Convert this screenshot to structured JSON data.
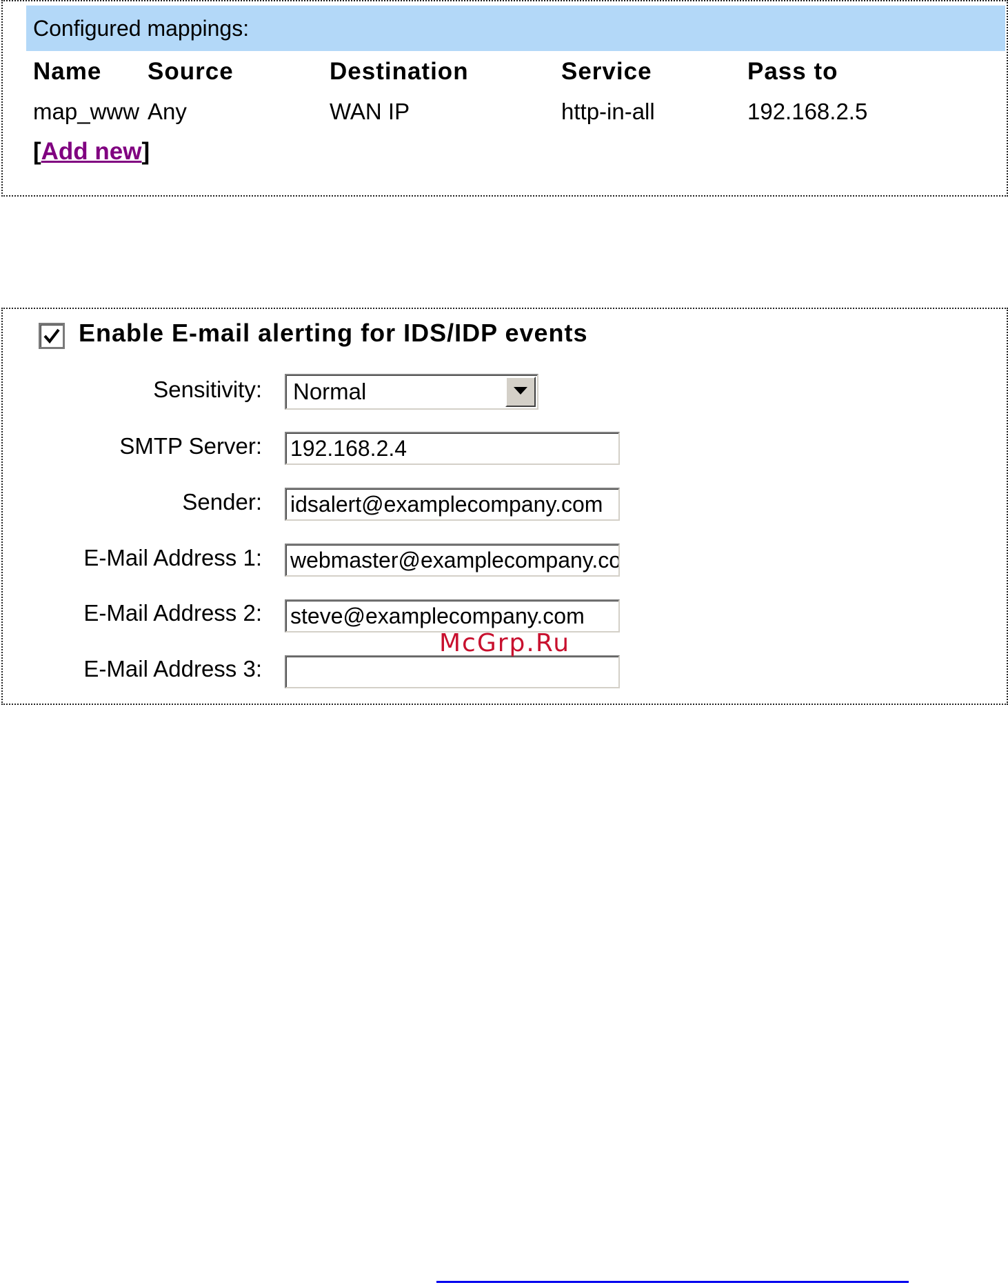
{
  "mappings": {
    "header": "Configured mappings:",
    "columns": [
      "Name",
      "Source",
      "Destination",
      "Service",
      "Pass to"
    ],
    "rows": [
      {
        "name": "map_www",
        "source": "Any",
        "destination": "WAN IP",
        "service": "http-in-all",
        "pass_to": "192.168.2.5"
      }
    ],
    "add_new_open": "[",
    "add_new_label": "Add new",
    "add_new_close": "]"
  },
  "alerting": {
    "enable_label": "Enable E-mail alerting for IDS/IDP events",
    "enabled": true,
    "fields": {
      "sensitivity": {
        "label": "Sensitivity:",
        "value": "Normal"
      },
      "smtp_server": {
        "label": "SMTP Server:",
        "value": "192.168.2.4"
      },
      "sender": {
        "label": "Sender:",
        "value": "idsalert@examplecompany.com"
      },
      "email1": {
        "label": "E-Mail Address 1:",
        "value": "webmaster@examplecompany.com"
      },
      "email2": {
        "label": "E-Mail Address 2:",
        "value": "steve@examplecompany.com"
      },
      "email3": {
        "label": "E-Mail Address 3:",
        "value": ""
      }
    }
  },
  "watermark": "McGrp.Ru",
  "icons": {
    "checkbox": "check-icon",
    "dropdown": "chevron-down-icon"
  },
  "colors": {
    "header_bg": "#b3d8f8",
    "link": "#800080",
    "watermark": "#c8102e"
  }
}
